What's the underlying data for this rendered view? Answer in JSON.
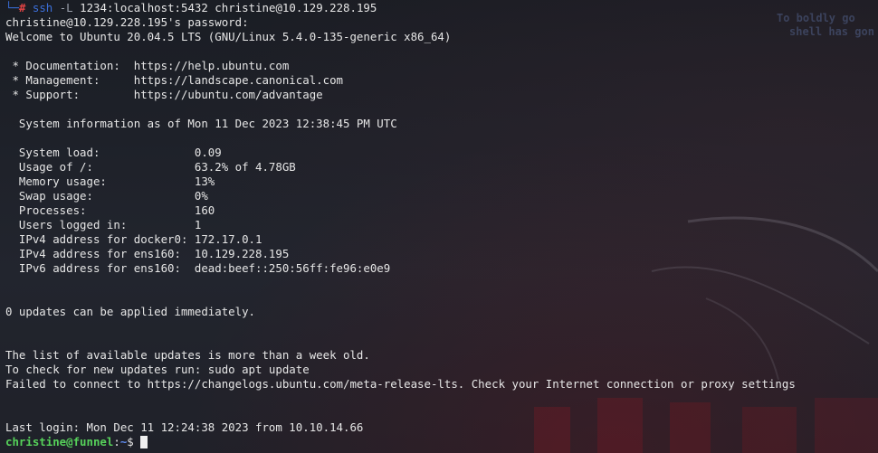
{
  "command": {
    "prompt_arrow": "└─",
    "hash": "#",
    "program": "ssh",
    "flag": "-L",
    "args": "1234:localhost:5432 christine@10.129.228.195"
  },
  "wallpaper": {
    "line1": "To boldly go ",
    "line2": "shell has gon"
  },
  "output_lines": [
    "christine@10.129.228.195's password: ",
    "Welcome to Ubuntu 20.04.5 LTS (GNU/Linux 5.4.0-135-generic x86_64)",
    "",
    " * Documentation:  https://help.ubuntu.com",
    " * Management:     https://landscape.canonical.com",
    " * Support:        https://ubuntu.com/advantage",
    "",
    "  System information as of Mon 11 Dec 2023 12:38:45 PM UTC",
    "",
    "  System load:              0.09",
    "  Usage of /:               63.2% of 4.78GB",
    "  Memory usage:             13%",
    "  Swap usage:               0%",
    "  Processes:                160",
    "  Users logged in:          1",
    "  IPv4 address for docker0: 172.17.0.1",
    "  IPv4 address for ens160:  10.129.228.195",
    "  IPv6 address for ens160:  dead:beef::250:56ff:fe96:e0e9",
    "",
    "",
    "0 updates can be applied immediately.",
    "",
    "",
    "The list of available updates is more than a week old.",
    "To check for new updates run: sudo apt update",
    "Failed to connect to https://changelogs.ubuntu.com/meta-release-lts. Check your Internet connection or proxy settings",
    "",
    "",
    "Last login: Mon Dec 11 12:24:38 2023 from 10.10.14.66"
  ],
  "final_prompt": {
    "user_host": "christine@funnel",
    "separator": ":",
    "path": "~",
    "symbol": "$ "
  }
}
